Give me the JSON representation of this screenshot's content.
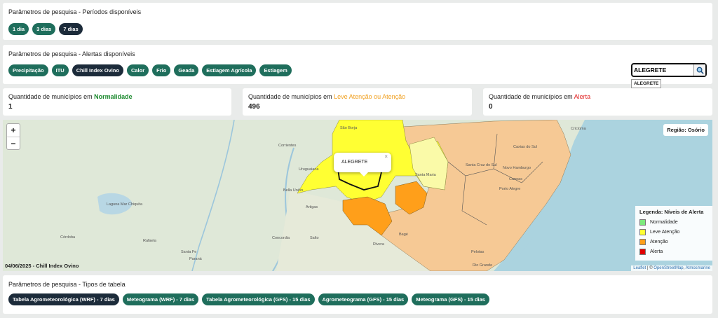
{
  "periods": {
    "title": "Parâmetros de pesquisa - Períodos disponíveis",
    "options": [
      "1 dia",
      "3 dias",
      "7 dias"
    ],
    "selected": "7 dias"
  },
  "alerts": {
    "title": "Parâmetros de pesquisa - Alertas disponíveis",
    "options": [
      "Precipitação",
      "ITU",
      "Chill Index Ovino",
      "Calor",
      "Frio",
      "Geada",
      "Estiagem Agrícola",
      "Estiagem"
    ],
    "selected": "Chill Index Ovino"
  },
  "search": {
    "value": "ALEGRETE",
    "suggestion": "ALEGRETE"
  },
  "stats": [
    {
      "label_prefix": "Quantidade de municípios em ",
      "level": "Normalidade",
      "value": "1"
    },
    {
      "label_prefix": "Quantidade de municípios em ",
      "level": "Leve Atenção ou Atenção",
      "value": "496"
    },
    {
      "label_prefix": "Quantidade de municípios em ",
      "level": "Alerta",
      "value": "0"
    }
  ],
  "map": {
    "zoom_in": "+",
    "zoom_out": "−",
    "region_label": "Região: Osório",
    "popup": {
      "text": "ALEGRETE",
      "close": "×"
    },
    "caption": "04/06/2025 - Chill Index Ovino",
    "attribution": {
      "leaflet": "Leaflet",
      "sep1": " | © ",
      "osm": "OpenStreetMap",
      "sep2": ", ",
      "atmos": "Atmosmarine"
    },
    "legend": {
      "title": "Legenda: Níveis de Alerta",
      "items": [
        {
          "label": "Normalidade",
          "color": "#7dea7d"
        },
        {
          "label": "Leve Atenção",
          "color": "#ffff33"
        },
        {
          "label": "Atenção",
          "color": "#ff9f1a"
        },
        {
          "label": "Alerta",
          "color": "#e00000"
        }
      ]
    },
    "places": [
      "Santa Fe",
      "Córdoba",
      "Rafaela",
      "Paraná",
      "Concordia",
      "Salto",
      "Artigas",
      "Rivera",
      "Bella Unión",
      "Uruguaiana",
      "Corrientes",
      "São Borja",
      "Santa Maria",
      "Bagé",
      "Porto Alegre",
      "Caxias do Sul",
      "Novo Hamburgo",
      "Canoas",
      "Santa Cruz do Sul",
      "Criciúma",
      "Pelotas",
      "Rio Grande",
      "Laguna Mar Chiquita"
    ]
  },
  "tables": {
    "title": "Parâmetros de pesquisa - Tipos de tabela",
    "options": [
      "Tabela Agrometeorológica (WRF) - 7 dias",
      "Meteograma (WRF) - 7 dias",
      "Tabela Agrometeorológica (GFS) - 15 dias",
      "Agrometeograma (GFS) - 15 dias",
      "Meteograma (GFS) - 15 dias"
    ],
    "selected": "Tabela Agrometeorológica (WRF) - 7 dias"
  }
}
